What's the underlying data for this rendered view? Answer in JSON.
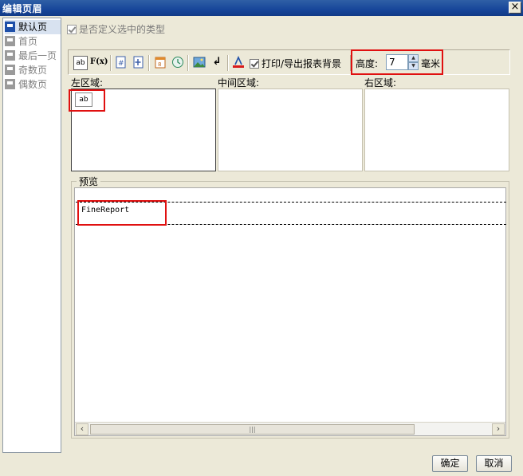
{
  "window": {
    "title": "编辑页眉",
    "close_glyph": "×"
  },
  "sidebar": {
    "items": [
      {
        "label": "默认页",
        "active": true
      },
      {
        "label": "首页"
      },
      {
        "label": "最后一页"
      },
      {
        "label": "奇数页"
      },
      {
        "label": "偶数页"
      }
    ]
  },
  "options": {
    "custom_types_label": "是否定义选中的类型",
    "custom_types_checked": true
  },
  "toolbar": {
    "icons": [
      "text-ab-icon",
      "formula-fx-icon",
      "page-number-icon",
      "total-pages-icon",
      "date-icon",
      "time-icon",
      "image-icon",
      "newline-icon",
      "font-style-icon"
    ],
    "text_ab": "ab",
    "text_fx": "F(x)",
    "print_bg_label": "打印/导出报表背景",
    "print_bg_checked": true,
    "height_label": "高度:",
    "height_value": "7",
    "height_unit": "毫米"
  },
  "regions": {
    "left_label": "左区域:",
    "middle_label": "中间区域:",
    "right_label": "右区域:",
    "left_item_text": "ab"
  },
  "preview": {
    "legend": "预览",
    "content_text": "FineReport",
    "scroll_left": "‹",
    "scroll_right": "›",
    "thumb_grip": "|||"
  },
  "buttons": {
    "ok": "确定",
    "cancel": "取消"
  },
  "colors": {
    "highlight": "#e01010",
    "titlebar": "#17469a"
  }
}
